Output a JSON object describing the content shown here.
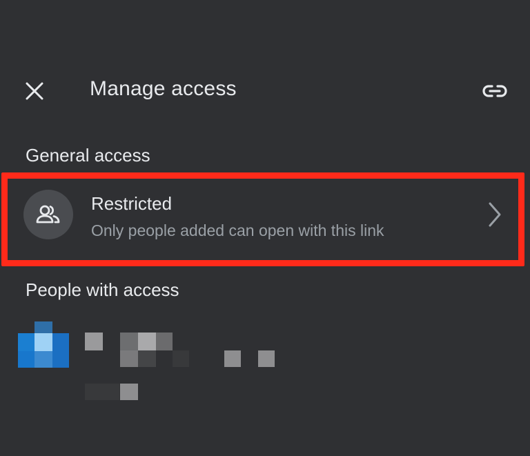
{
  "header": {
    "title": "Manage access",
    "close_icon": "close-icon",
    "link_icon": "link-icon"
  },
  "general_access": {
    "heading": "General access",
    "item": {
      "icon": "people-icon",
      "title": "Restricted",
      "subtitle": "Only people added can open with this link",
      "chevron_icon": "chevron-right-icon"
    }
  },
  "people_with_access": {
    "heading": "People with access"
  },
  "colors": {
    "background": "#2f3033",
    "highlight": "#ff2a1a",
    "text_primary": "#e8eaed",
    "text_secondary": "#9aa0a6"
  }
}
